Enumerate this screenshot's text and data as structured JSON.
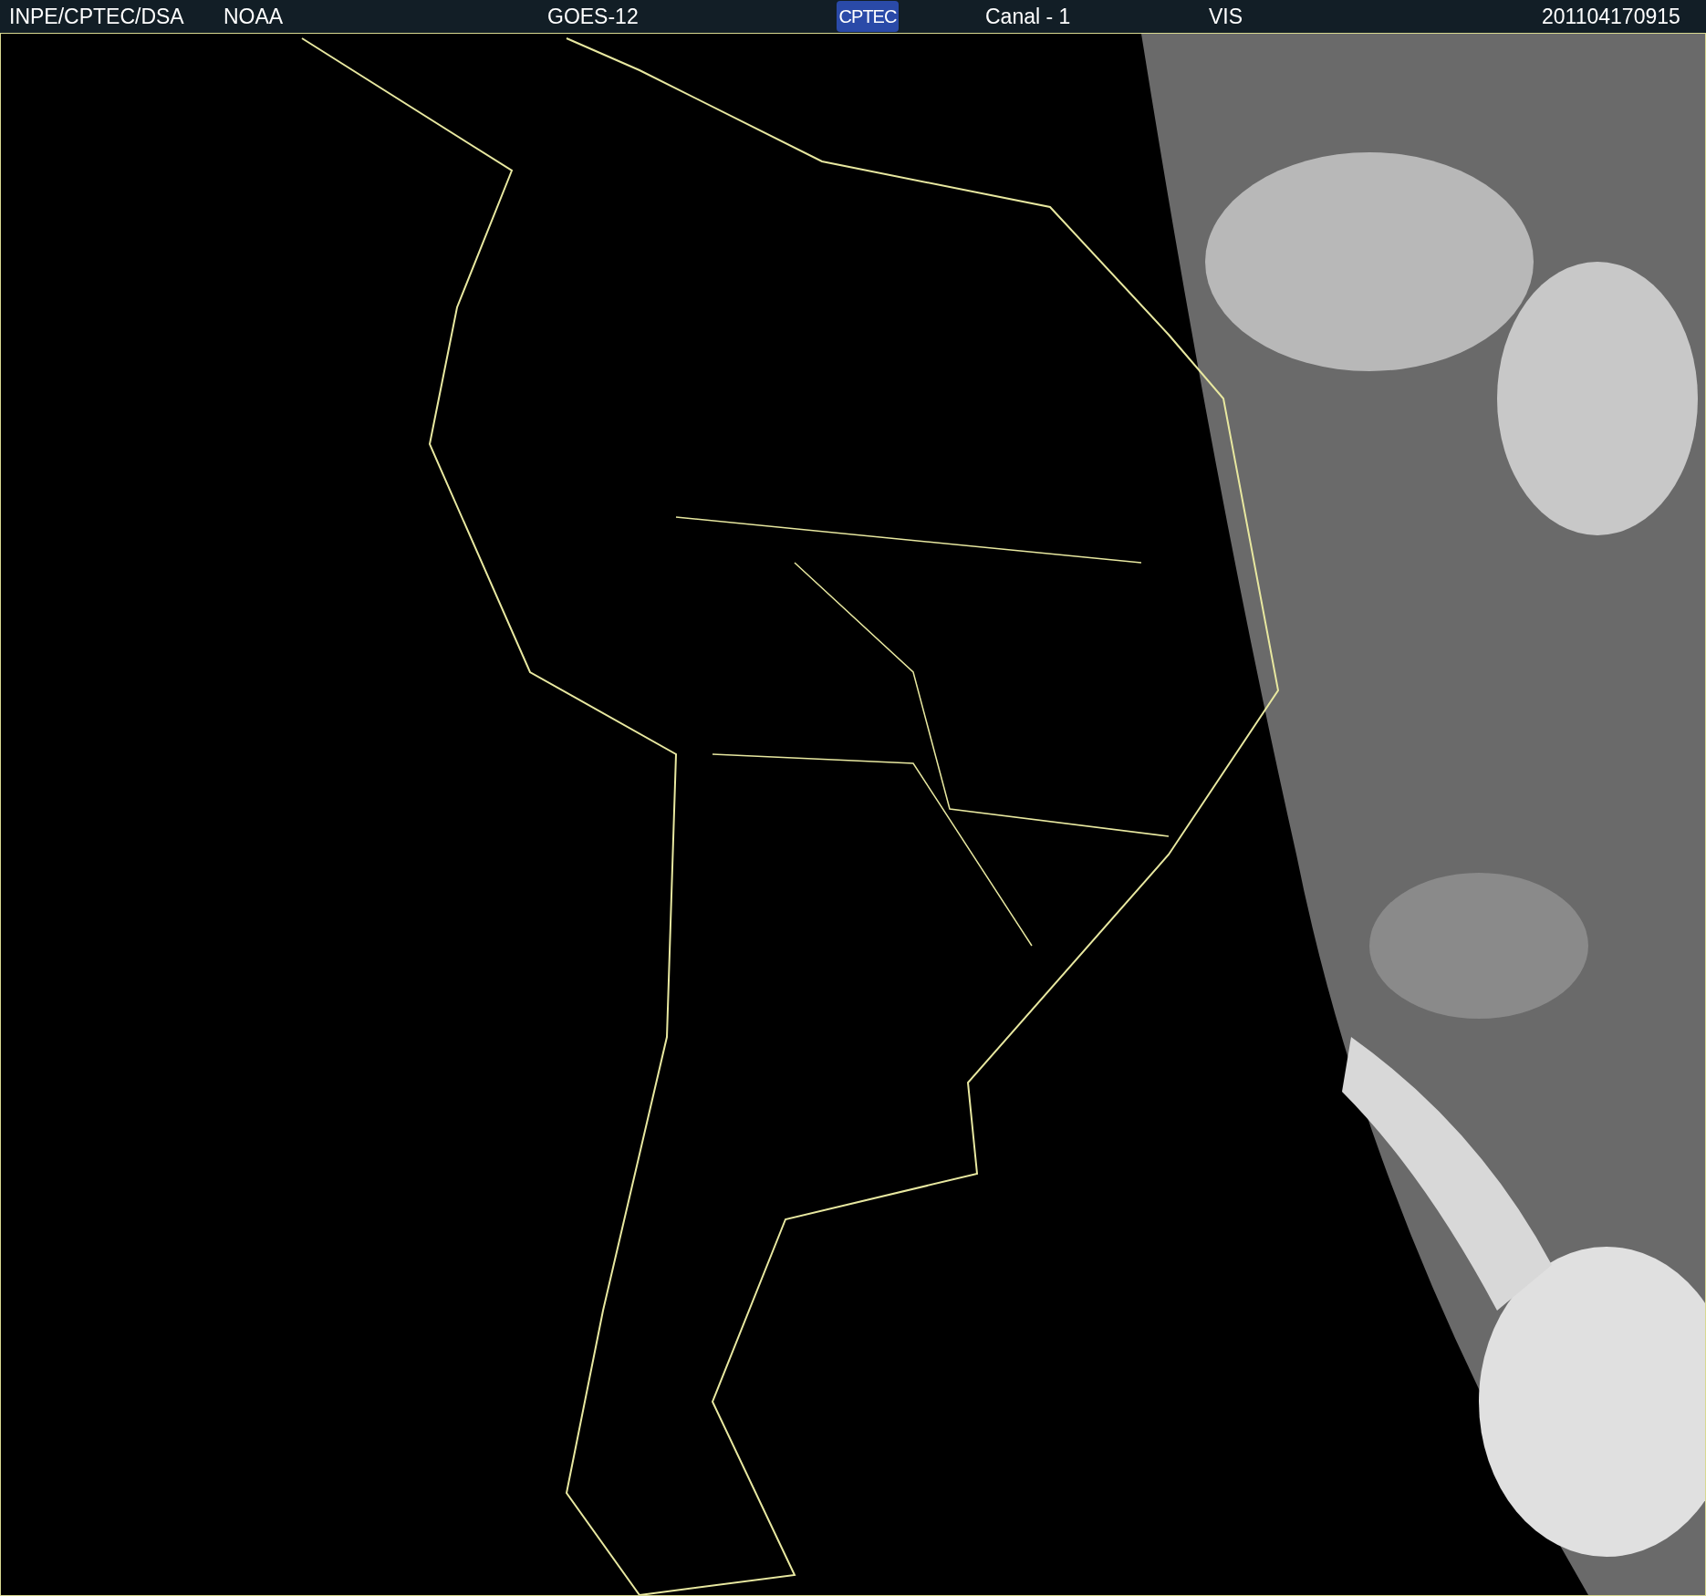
{
  "header": {
    "items": [
      {
        "kind": "text",
        "text": "INPE/CPTEC/DSA"
      },
      {
        "kind": "text",
        "text": "NOAA"
      },
      {
        "kind": "text",
        "text": "GOES-12"
      },
      {
        "kind": "logo",
        "text": "CPTEC"
      },
      {
        "kind": "text",
        "text": "Canal - 1"
      },
      {
        "kind": "text",
        "text": "VIS"
      },
      {
        "kind": "text",
        "text": "201104170915"
      }
    ]
  }
}
